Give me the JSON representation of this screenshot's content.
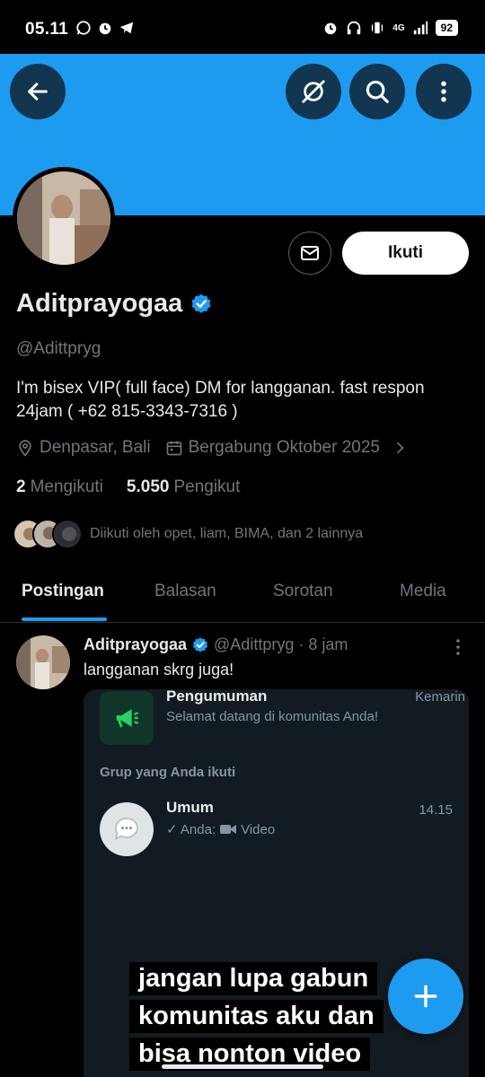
{
  "status_bar": {
    "time": "05.11",
    "network": "4G",
    "battery": "92"
  },
  "profile": {
    "display_name": "Aditprayogaa",
    "handle": "@Adittpryg",
    "bio_line1": "I'm bisex VIP( full face) DM for langganan. fast respon",
    "bio_line2": "24jam ( +62 815-3343-7316 )",
    "location": "Denpasar, Bali",
    "joined": "Bergabung Oktober 2025",
    "following_count": "2",
    "following_label": "Mengikuti",
    "followers_count": "5.050",
    "followers_label": "Pengikut",
    "followed_by": "Diikuti oleh opet, liam, BIMA, dan 2 lainnya",
    "follow_label": "Ikuti"
  },
  "tabs": [
    {
      "label": "Postingan",
      "active": true
    },
    {
      "label": "Balasan",
      "active": false
    },
    {
      "label": "Sorotan",
      "active": false
    },
    {
      "label": "Media",
      "active": false
    }
  ],
  "post": {
    "name": "Aditprayogaa",
    "handle": "@Adittpryg",
    "time": "· 8 jam",
    "text": "langganan skrg juga!",
    "media": {
      "announcement_title": "Pengumuman",
      "announcement_time": "Kemarin",
      "announcement_sub": "Selamat datang di komunitas Anda!",
      "groups_heading": "Grup yang Anda ikuti",
      "group_title": "Umum",
      "group_time": "14.15",
      "group_sub_prefix": "✓ Anda:",
      "group_sub_type": "Video",
      "caption_line1": "jangan lupa gabun",
      "caption_line2": "komunitas aku dan",
      "caption_line3": "bisa nonton video"
    }
  },
  "colors": {
    "accent": "#1d9bf0",
    "background": "#000000",
    "muted": "#71767b"
  }
}
